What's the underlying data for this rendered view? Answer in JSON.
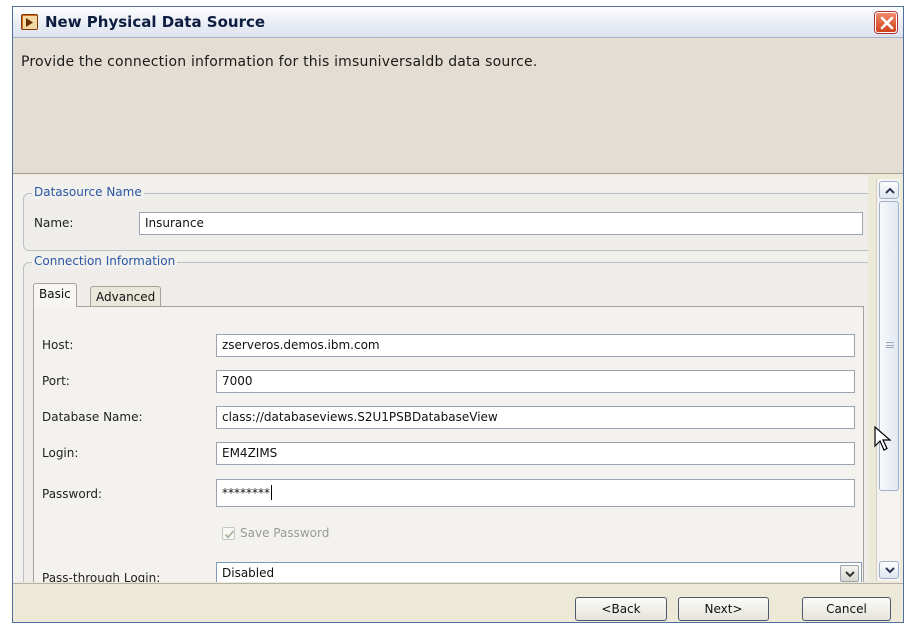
{
  "window": {
    "title": "New Physical Data Source",
    "app_icon": "wizard-app-icon",
    "close_icon": "close-icon"
  },
  "description": "Provide the connection information for this imsuniversaldb data source.",
  "datasource": {
    "legend": "Datasource Name",
    "name_label": "Name:",
    "name_value": "Insurance"
  },
  "connection": {
    "legend": "Connection Information",
    "tabs": [
      {
        "label": "Basic",
        "active": true
      },
      {
        "label": "Advanced",
        "active": false
      }
    ],
    "host_label": "Host:",
    "host_value": "zserveros.demos.ibm.com",
    "port_label": "Port:",
    "port_value": "7000",
    "database_label": "Database Name:",
    "database_value": "class://databaseviews.S2U1PSBDatabaseView",
    "login_label": "Login:",
    "login_value": "EM4ZIMS",
    "password_label": "Password:",
    "password_value": "********",
    "save_password_label": "Save Password",
    "save_password_checked": true,
    "passthrough_label": "Pass-through Login:",
    "passthrough_value": "Disabled"
  },
  "buttons": {
    "back": "<Back",
    "next": "Next>",
    "cancel": "Cancel"
  },
  "colors": {
    "legend_blue": "#2b57a5",
    "description_bg": "#e4ddd3",
    "close_red": "#d2411c"
  }
}
